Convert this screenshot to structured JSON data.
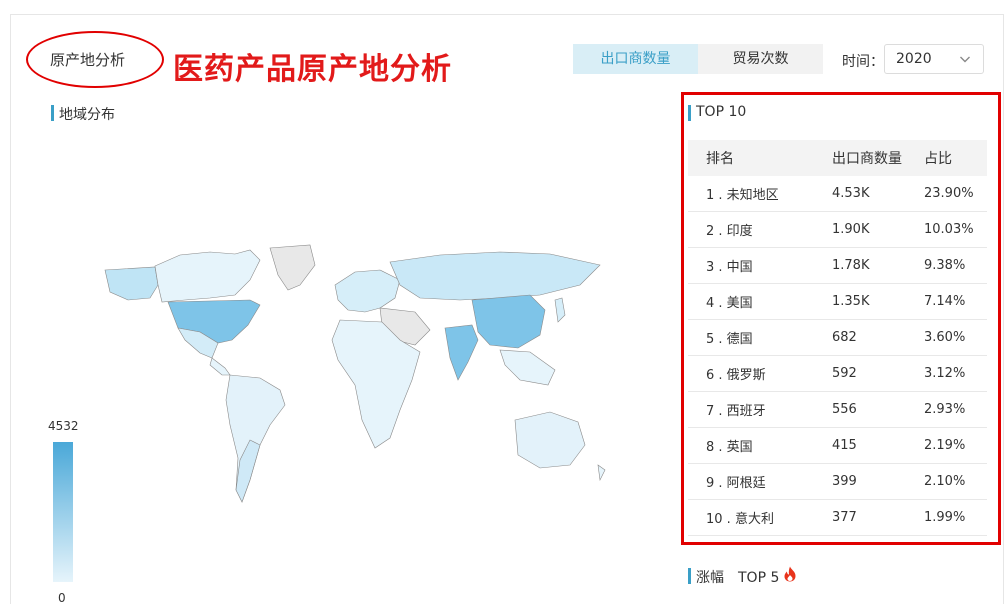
{
  "header": {
    "title_small": "原产地分析",
    "title_big": "医药产品原产地分析"
  },
  "toggle": {
    "options": [
      "出口商数量",
      "贸易次数"
    ],
    "active_index": 0
  },
  "time_filter": {
    "label": "时间：",
    "value": "2020"
  },
  "map_section": {
    "title": "地域分布",
    "legend_max": "4532",
    "legend_min": "0",
    "color_high": "#4aa8d8",
    "color_low": "#e6f4fb"
  },
  "top10": {
    "title": "TOP 10",
    "columns": [
      "排名",
      "出口商数量",
      "占比"
    ],
    "rows": [
      {
        "rank": "1 . 未知地区",
        "count": "4.53K",
        "ratio": "23.90%"
      },
      {
        "rank": "2 . 印度",
        "count": "1.90K",
        "ratio": "10.03%"
      },
      {
        "rank": "3 . 中国",
        "count": "1.78K",
        "ratio": "9.38%"
      },
      {
        "rank": "4 . 美国",
        "count": "1.35K",
        "ratio": "7.14%"
      },
      {
        "rank": "5 . 德国",
        "count": "682",
        "ratio": "3.60%"
      },
      {
        "rank": "6 . 俄罗斯",
        "count": "592",
        "ratio": "3.12%"
      },
      {
        "rank": "7 . 西班牙",
        "count": "556",
        "ratio": "2.93%"
      },
      {
        "rank": "8 . 英国",
        "count": "415",
        "ratio": "2.19%"
      },
      {
        "rank": "9 . 阿根廷",
        "count": "399",
        "ratio": "2.10%"
      },
      {
        "rank": "10 . 意大利",
        "count": "377",
        "ratio": "1.99%"
      }
    ]
  },
  "growth": {
    "title": "涨幅　TOP 5",
    "icon": "fire-icon",
    "icon_color": "#e8341c"
  },
  "accent_color": "#3a9fc7",
  "highlight_color": "#e10000"
}
